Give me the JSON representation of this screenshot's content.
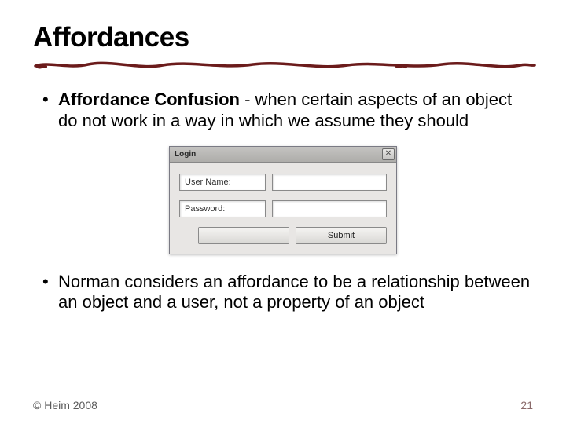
{
  "title": "Affordances",
  "bullets": [
    {
      "bold": "Affordance Confusion",
      "rest": " - when certain aspects of an object do not work in a way in which we assume they should"
    },
    {
      "bold": "",
      "rest": "Norman considers an affordance to be a relationship between an object and a user, not a property of an object"
    }
  ],
  "dialog": {
    "title": "Login",
    "username_label": "User Name:",
    "password_label": "Password:",
    "submit_label": "Submit"
  },
  "footer": {
    "copyright": "© Heim 2008",
    "page": "21"
  },
  "colors": {
    "underline": "#6b1b1b"
  }
}
